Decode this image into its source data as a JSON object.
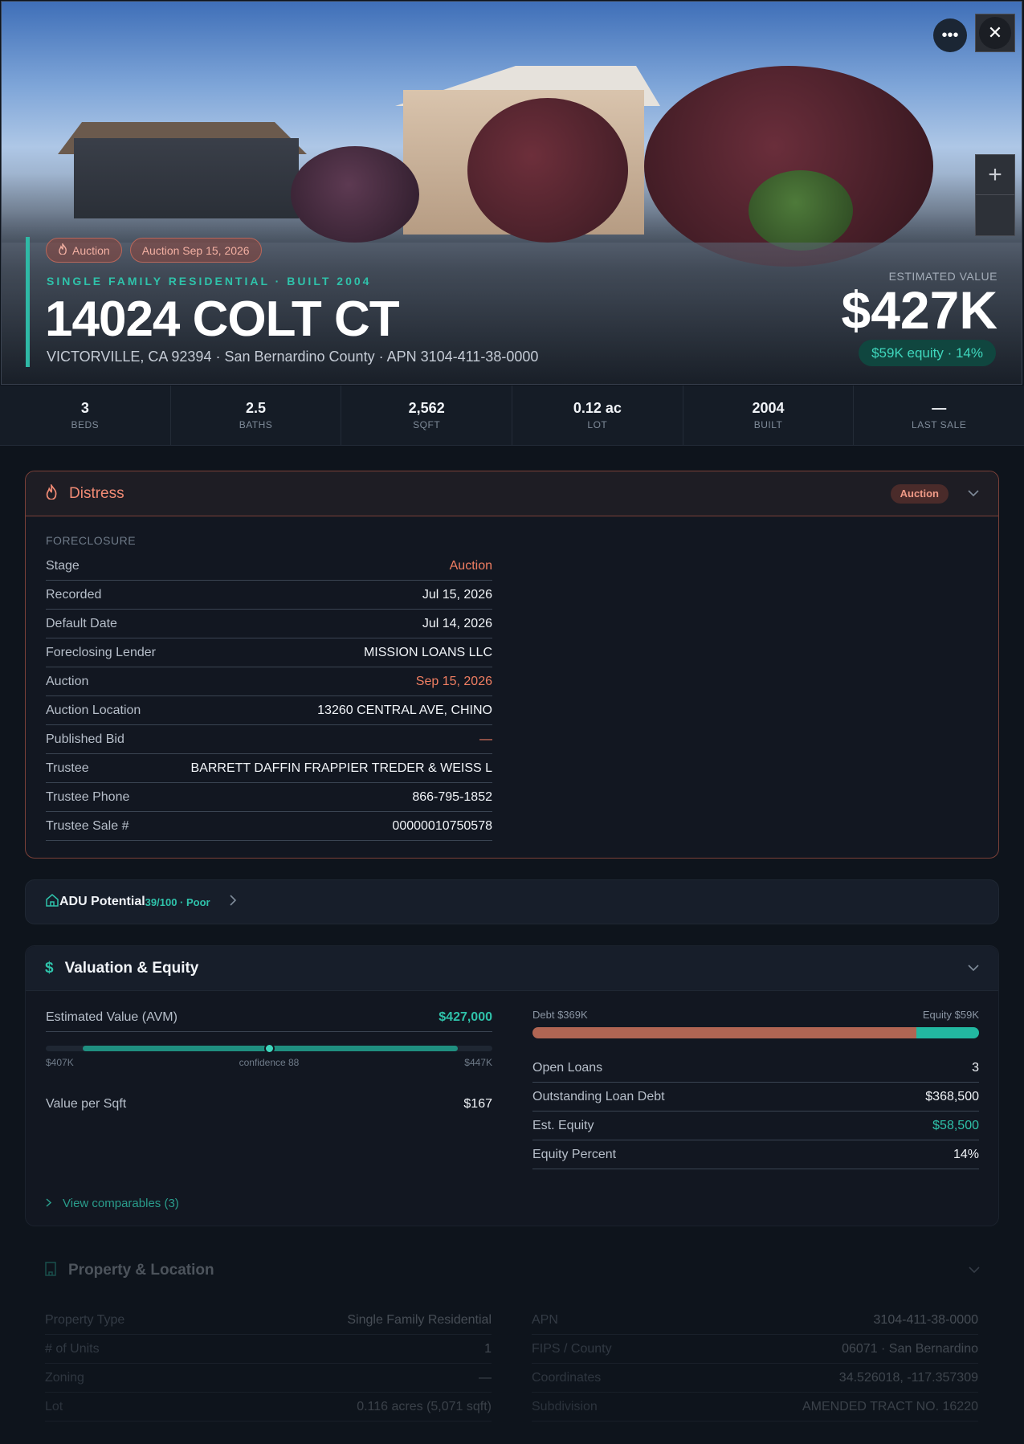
{
  "hero": {
    "chips": [
      {
        "icon": "flame-icon",
        "label": "Auction"
      },
      {
        "label": "Auction Sep 15, 2026"
      }
    ],
    "eyebrow": "SINGLE FAMILY RESIDENTIAL · BUILT 2004",
    "address": "14024 COLT CT",
    "subaddress": "VICTORVILLE, CA 92394 · San Bernardino County · APN 3104-411-38-0000",
    "est_label": "ESTIMATED VALUE",
    "est_value": "$427K",
    "equity_pill": "$59K equity · 14%",
    "controls": {
      "more": "more-icon",
      "close": "close-icon",
      "zoom_in": "+"
    }
  },
  "stats": [
    {
      "value": "3",
      "label": "BEDS"
    },
    {
      "value": "2.5",
      "label": "BATHS"
    },
    {
      "value": "2,562",
      "label": "SQFT"
    },
    {
      "value": "0.12 ac",
      "label": "LOT"
    },
    {
      "value": "2004",
      "label": "BUILT"
    },
    {
      "value": "—",
      "label": "LAST SALE"
    }
  ],
  "distress": {
    "title": "Distress",
    "badge": "Auction",
    "section": "FORECLOSURE",
    "rows": [
      {
        "k": "Stage",
        "v": "Auction",
        "accent": "red"
      },
      {
        "k": "Recorded",
        "v": "Jul 15, 2026"
      },
      {
        "k": "Default Date",
        "v": "Jul 14, 2026"
      },
      {
        "k": "Foreclosing Lender",
        "v": "MISSION LOANS LLC"
      },
      {
        "k": "Auction",
        "v": "Sep 15, 2026",
        "accent": "red"
      },
      {
        "k": "Auction Location",
        "v": "13260 CENTRAL AVE, CHINO"
      },
      {
        "k": "Published Bid",
        "v": "—",
        "accent": "red"
      },
      {
        "k": "Trustee",
        "v": "BARRETT DAFFIN FRAPPIER TREDER & WEISS L"
      },
      {
        "k": "Trustee Phone",
        "v": "866-795-1852"
      },
      {
        "k": "Trustee Sale #",
        "v": "00000010750578"
      }
    ]
  },
  "adu": {
    "title": "ADU Potential",
    "score": "39/100 · Poor"
  },
  "valuation": {
    "title": "Valuation & Equity",
    "avm_label": "Estimated Value (AVM)",
    "avm_value": "$427,000",
    "range_low": "$407K",
    "range_mid": "confidence 88",
    "range_high": "$447K",
    "range_fraction": 0.5,
    "vps_label": "Value per Sqft",
    "vps_value": "$167",
    "debt_label": "Debt $369K",
    "equity_label": "Equity $59K",
    "equity_fraction": 0.14,
    "rows": [
      {
        "k": "Open Loans",
        "v": "3"
      },
      {
        "k": "Outstanding Loan Debt",
        "v": "$368,500"
      },
      {
        "k": "Est. Equity",
        "v": "$58,500",
        "accent": "green"
      },
      {
        "k": "Equity Percent",
        "v": "14%"
      }
    ],
    "comps": "View comparables (3)"
  },
  "property": {
    "title": "Property & Location",
    "left": [
      {
        "k": "Property Type",
        "v": "Single Family Residential"
      },
      {
        "k": "# of Units",
        "v": "1"
      },
      {
        "k": "Zoning",
        "v": "—"
      },
      {
        "k": "Lot",
        "v": "0.116 acres (5,071 sqft)"
      }
    ],
    "right": [
      {
        "k": "APN",
        "v": "3104-411-38-0000"
      },
      {
        "k": "FIPS / County",
        "v": "06071 · San Bernardino"
      },
      {
        "k": "Coordinates",
        "v": "34.526018, -117.357309"
      },
      {
        "k": "Subdivision",
        "v": "AMENDED TRACT NO. 16220"
      }
    ]
  },
  "colors": {
    "accent": "#2fc2aa",
    "distress": "#f07e62",
    "debt": "#b06553",
    "equity": "#22b8a1"
  }
}
